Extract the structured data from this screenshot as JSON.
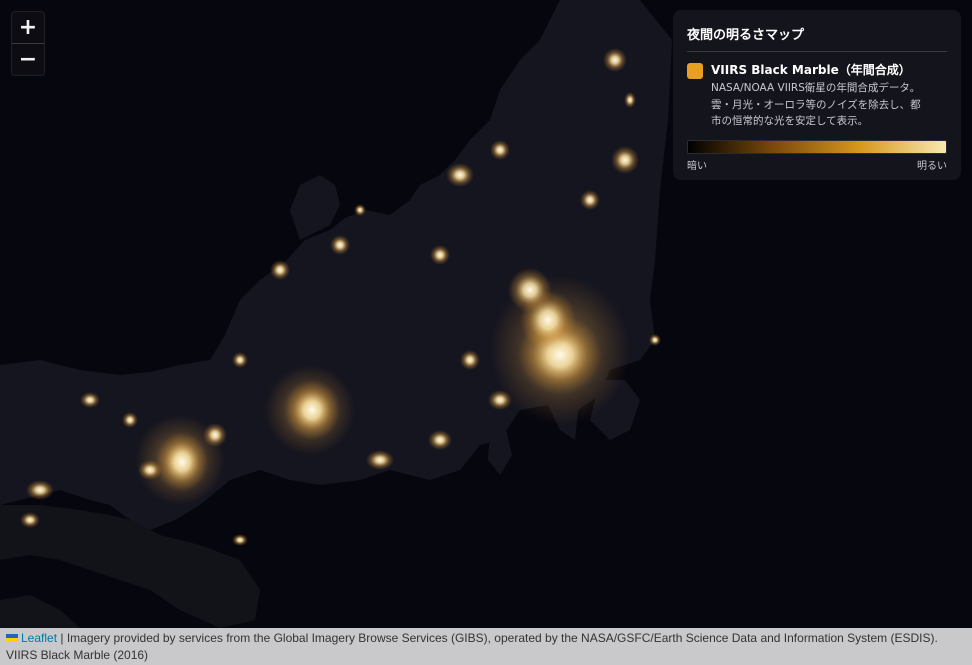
{
  "map": {
    "zoom_in_label": "+",
    "zoom_out_label": "−"
  },
  "legend": {
    "title": "夜間の明るさマップ",
    "layer_name": "VIIRS Black Marble（年間合成）",
    "description_lines": [
      "NASA/NOAA VIIRS衛星の年間合成データ。",
      "雲・月光・オーロラ等のノイズを除去し、都",
      "市の恒常的な光を安定して表示。"
    ],
    "min_label": "暗い",
    "max_label": "明るい",
    "swatch_color": "#e8a020",
    "ramp_colors": [
      "#000000",
      "#7a4a0c",
      "#d8981e",
      "#f8e8b0"
    ]
  },
  "attribution": {
    "link": "Leaflet",
    "separator": " | ",
    "text": "Imagery provided by services from the Global Imagery Browse Services (GIBS), operated by the NASA/GSFC/Earth Science Data and Information System (ESDIS).",
    "layer_credit": "VIIRS Black Marble (2016)"
  },
  "colors": {
    "background": "#06060e",
    "land": "#15151f",
    "light_core": "#fffbea",
    "light_glow": "#f5b540"
  }
}
